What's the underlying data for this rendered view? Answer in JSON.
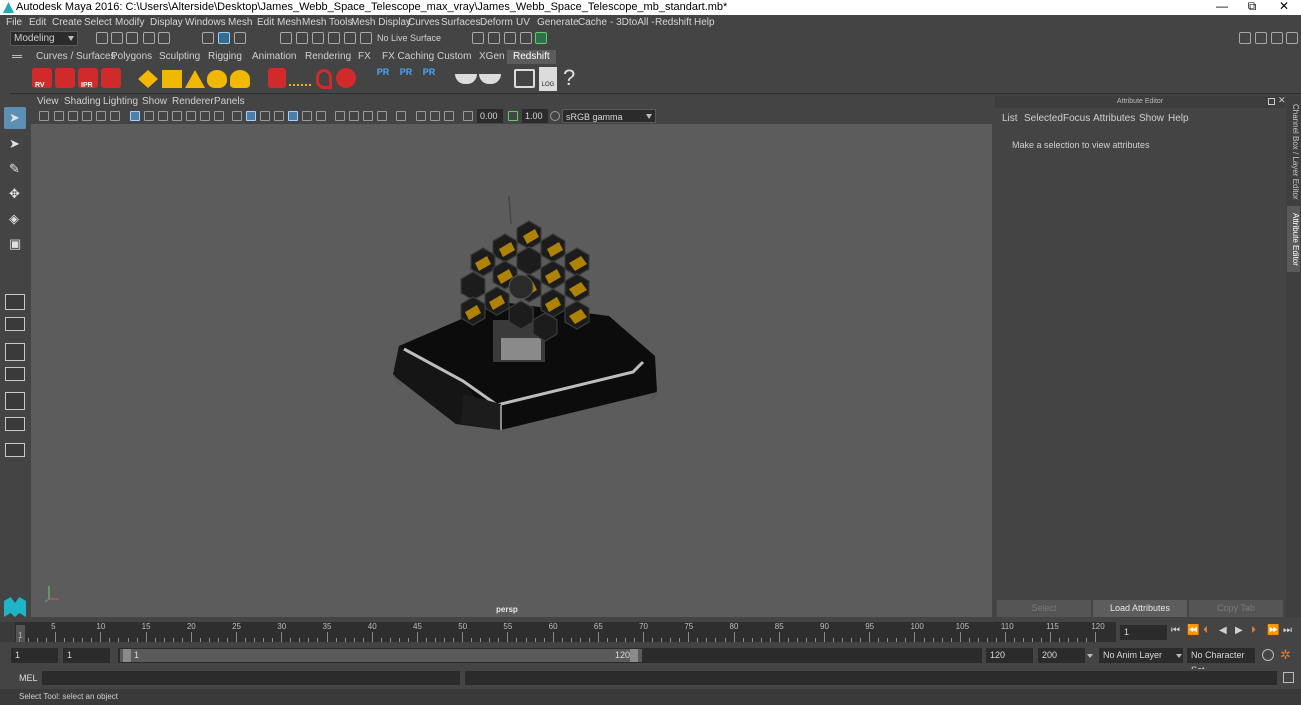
{
  "app": {
    "title": "Autodesk Maya 2016: C:\\Users\\Alterside\\Desktop\\James_Webb_Space_Telescope_max_vray\\James_Webb_Space_Telescope_mb_standart.mb*",
    "minimize": "—",
    "restore": "⧉",
    "close": "✕"
  },
  "menu": [
    "File",
    "Edit",
    "Create",
    "Select",
    "Modify",
    "Display",
    "Windows",
    "Mesh",
    "Edit Mesh",
    "Mesh Tools",
    "Mesh Display",
    "Curves",
    "Surfaces",
    "Deform",
    "UV",
    "Generate",
    "Cache",
    "- 3DtoAll -",
    "Redshift",
    "Help"
  ],
  "status": {
    "mode": "Modeling",
    "live_surface": "No Live Surface"
  },
  "shelf": {
    "tabs": [
      "Curves / Surfaces",
      "Polygons",
      "Sculpting",
      "Rigging",
      "Animation",
      "Rendering",
      "FX",
      "FX Caching",
      "Custom",
      "XGen",
      "Redshift"
    ],
    "active_tab": "Redshift",
    "rs_labels": [
      "RV",
      "IPR"
    ],
    "pr_label": "PR",
    "log_label": "LOG",
    "help_glyph": "?"
  },
  "viewport": {
    "menu": [
      "View",
      "Shading",
      "Lighting",
      "Show",
      "Renderer",
      "Panels"
    ],
    "exposure": "0.00",
    "gamma": "1.00",
    "color_space": "sRGB gamma",
    "camera_label": "persp"
  },
  "attribute_editor": {
    "title": "Attribute Editor",
    "menu": [
      "List",
      "Selected",
      "Focus",
      "Attributes",
      "Show",
      "Help"
    ],
    "hint": "Make a selection to view attributes",
    "buttons": [
      "Select",
      "Load Attributes",
      "Copy Tab"
    ]
  },
  "side_tabs": [
    "Channel Box / Layer Editor",
    "Attribute Editor"
  ],
  "timeline": {
    "ticks": [
      "5",
      "10",
      "15",
      "20",
      "25",
      "30",
      "35",
      "40",
      "45",
      "50",
      "55",
      "60",
      "65",
      "70",
      "75",
      "80",
      "85",
      "90",
      "95",
      "100",
      "105",
      "110",
      "115",
      "120"
    ],
    "start_tick": "1",
    "current_frame": "1"
  },
  "range": {
    "start": "1",
    "playback_start": "1",
    "slider_start": "1",
    "slider_end": "120",
    "playback_end": "120",
    "end": "200",
    "anim_layer": "No Anim Layer",
    "char_set": "No Character Set"
  },
  "command": {
    "label": "MEL"
  },
  "help_line": "Select Tool: select an object",
  "colors": {
    "selected_tool": "#5d8fb3",
    "redshift_red": "#d02a2a",
    "mirror_gold": "#f0b800",
    "viewport_bg": "#5c5c5c"
  }
}
